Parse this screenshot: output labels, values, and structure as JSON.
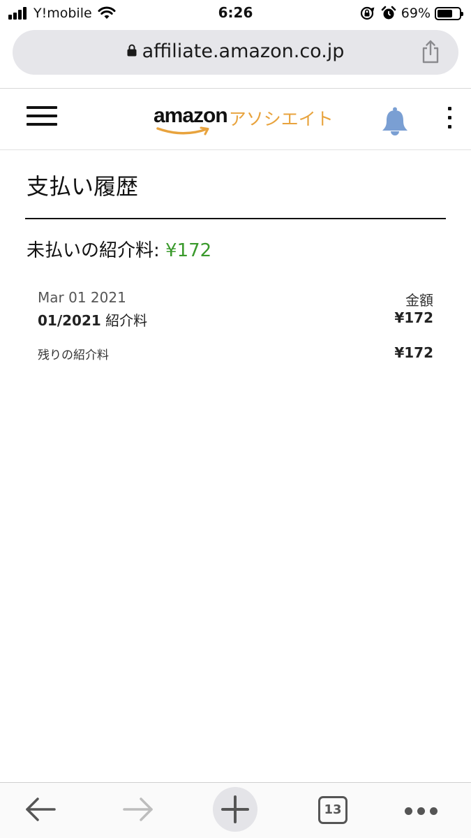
{
  "status_bar": {
    "carrier": "Y!mobile",
    "time": "6:26",
    "battery_percent": "69%",
    "battery_level": 0.69,
    "icons": [
      "signal-icon",
      "wifi-icon",
      "rotation-lock-icon",
      "alarm-icon",
      "battery-icon"
    ]
  },
  "browser": {
    "url": "affiliate.amazon.co.jp",
    "tab_count": "13"
  },
  "header": {
    "logo_word": "amazon",
    "logo_suffix": "アソシエイト"
  },
  "page": {
    "title": "支払い履歴",
    "unpaid_label": "未払いの紹介料: ",
    "unpaid_amount": "¥172",
    "payment": {
      "date": "Mar 01 2021",
      "amount_header": "金額",
      "period": "01/2021",
      "desc_suffix": " 紹介料",
      "amount": "¥172",
      "remaining_label": "残りの紹介料",
      "remaining_amount": "¥172"
    }
  },
  "colors": {
    "accent_green": "#3a9a2c",
    "logo_orange": "#e8a33d",
    "bell_blue": "#7a9fd3"
  }
}
